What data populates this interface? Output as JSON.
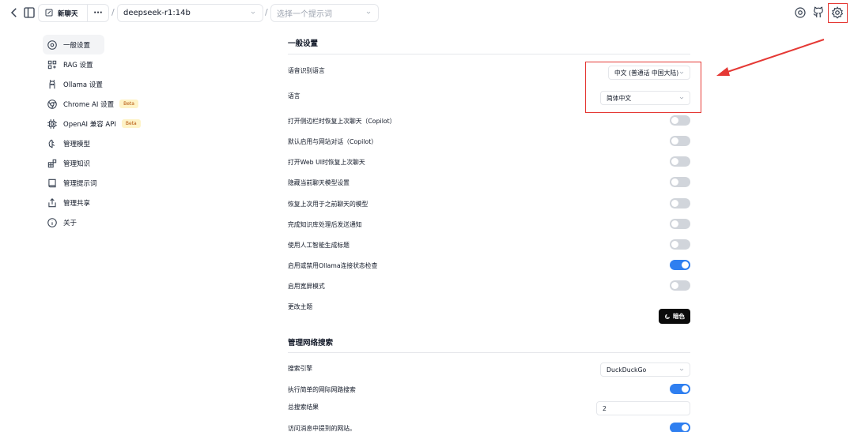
{
  "topbar": {
    "new_chat_label": "新聊天",
    "more_label": "···",
    "model_value": "deepseek-r1:14b",
    "prompt_placeholder": "选择一个提示词",
    "slash": "/"
  },
  "sidebar": {
    "items": [
      {
        "label": "一般设置",
        "icon": "settings-circle-icon"
      },
      {
        "label": "RAG 设置",
        "icon": "rag-icon"
      },
      {
        "label": "Ollama 设置",
        "icon": "ollama-icon"
      },
      {
        "label": "Chrome AI 设置",
        "icon": "chrome-icon",
        "badge": "Beta"
      },
      {
        "label": "OpenAI 兼容 API",
        "icon": "chip-icon",
        "badge": "Beta"
      },
      {
        "label": "管理模型",
        "icon": "brain-icon"
      },
      {
        "label": "管理知识",
        "icon": "blocks-icon"
      },
      {
        "label": "管理提示词",
        "icon": "book-icon"
      },
      {
        "label": "管理共享",
        "icon": "share-icon"
      },
      {
        "label": "关于",
        "icon": "info-icon"
      }
    ]
  },
  "general": {
    "title": "一般设置",
    "speech_lang_label": "语音识别语言",
    "speech_lang_value": "中文 (普通话 中国大陆)",
    "lang_label": "语言",
    "lang_value": "简体中文",
    "toggles": [
      {
        "label": "打开侧边栏时恢复上次聊天（Copilot）",
        "on": false
      },
      {
        "label": "默认启用与网站对话（Copilot）",
        "on": false
      },
      {
        "label": "打开Web UI时恢复上次聊天",
        "on": false
      },
      {
        "label": "隐藏当前聊天模型设置",
        "on": false
      },
      {
        "label": "恢复上次用于之前聊天的模型",
        "on": false
      },
      {
        "label": "完成知识库处理后发送通知",
        "on": false
      },
      {
        "label": "使用人工智能生成标题",
        "on": false
      },
      {
        "label": "启用或禁用Ollama连接状态检查",
        "on": true
      },
      {
        "label": "启用宽屏模式",
        "on": false
      }
    ],
    "theme_label": "更改主题",
    "theme_button": "暗色"
  },
  "websearch": {
    "title": "管理网络搜索",
    "engine_label": "搜索引擎",
    "engine_value": "DuckDuckGo",
    "simple_label": "执行简单的网际网路搜索",
    "simple_on": true,
    "total_label": "总搜索结果",
    "total_value": "2",
    "visit_label": "访问消息中提到的网站。",
    "visit_on": true
  },
  "colors": {
    "accent": "#2f7ff0",
    "annotation": "#e53935"
  }
}
